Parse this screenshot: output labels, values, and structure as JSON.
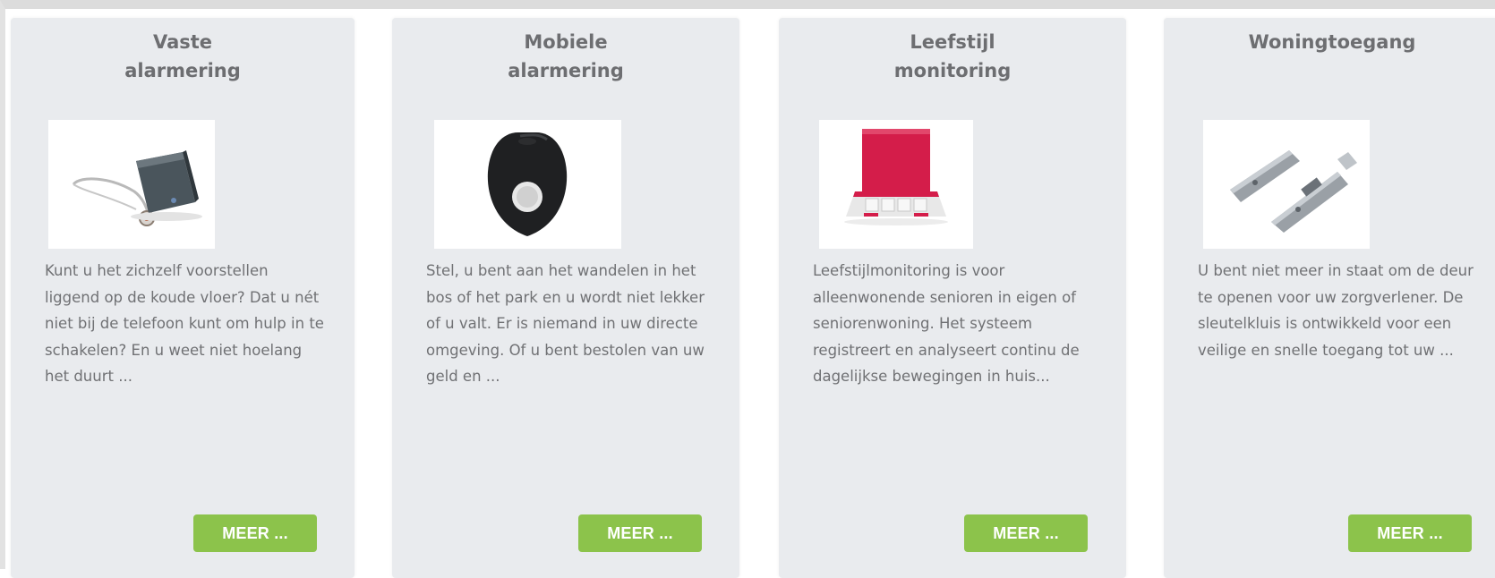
{
  "cards": [
    {
      "title_line1": "Vaste",
      "title_line2": "alarmering",
      "image_icon": "alarm-base-station-with-pendant-icon",
      "text": "Kunt u het zichzelf voorstellen liggend op de koude vloer? Dat u nét niet bij de telefoon kunt om hulp in te schakelen? En u weet niet hoelang het duurt ...",
      "button_label": "MEER ..."
    },
    {
      "title_line1": "Mobiele",
      "title_line2": "alarmering",
      "image_icon": "mobile-alarm-device-icon",
      "text": "Stel, u bent aan het wandelen in het bos of het park en u wordt niet lekker of u valt. Er is niemand in uw directe omgeving. Of u bent bestolen van uw geld en ...",
      "button_label": "MEER ..."
    },
    {
      "title_line1": "Leefstijl",
      "title_line2": "monitoring",
      "image_icon": "monitoring-kit-box-icon",
      "text": "Leefstijlmonitoring is voor alleenwonende senioren in eigen of seniorenwoning. Het systeem registreert en analyseert continu de dagelijkse bewegingen in huis...",
      "button_label": "MEER ..."
    },
    {
      "title_line1": "Woningtoegang",
      "title_line2": "",
      "image_icon": "key-safe-icon",
      "text": "U bent niet meer in staat om de deur te openen voor uw zorgverlener. De sleutelkluis is ontwikkeld voor een veilige en snelle toegang tot uw ...",
      "button_label": "MEER ..."
    }
  ],
  "colors": {
    "card_background": "#e9ebee",
    "title_text": "#6d6e71",
    "body_text": "#707174",
    "button_background": "#8cc34b",
    "button_text": "#ffffff"
  }
}
